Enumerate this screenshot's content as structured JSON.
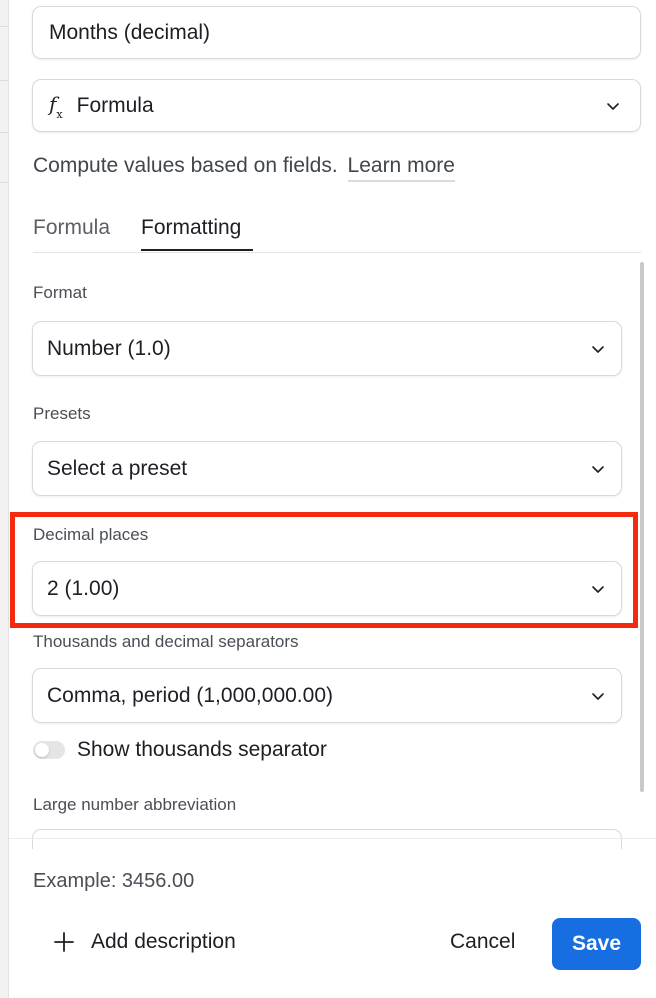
{
  "field_name": {
    "value": "Months (decimal)"
  },
  "field_type": {
    "label": "Formula",
    "icon": "formula-fx-icon"
  },
  "description": {
    "text": "Compute values based on fields.",
    "learn_more": "Learn more"
  },
  "tabs": [
    {
      "label": "Formula",
      "active": false
    },
    {
      "label": "Formatting",
      "active": true
    }
  ],
  "format": {
    "label": "Format",
    "value": "Number (1.0)"
  },
  "presets": {
    "label": "Presets",
    "value": "Select a preset"
  },
  "decimal_places": {
    "label": "Decimal places",
    "value": "2 (1.00)"
  },
  "separators": {
    "label": "Thousands and decimal separators",
    "value": "Comma, period (1,000,000.00)"
  },
  "show_thousands": {
    "label": "Show thousands separator",
    "enabled": false
  },
  "large_number": {
    "label": "Large number abbreviation"
  },
  "example": {
    "text": "Example: 3456.00"
  },
  "footer": {
    "add_description": "Add description",
    "cancel": "Cancel",
    "save": "Save"
  },
  "colors": {
    "accent": "#166ee1",
    "highlight": "#f12a10"
  }
}
